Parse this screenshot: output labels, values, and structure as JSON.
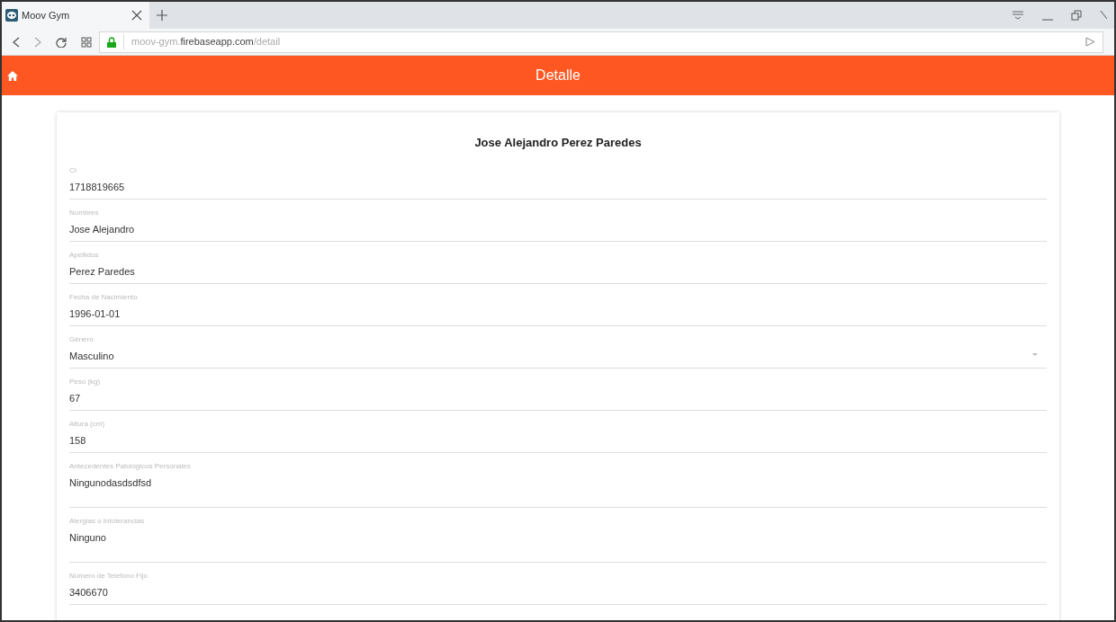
{
  "browser": {
    "tab_title": "Moov Gym",
    "url": {
      "subdomain": "moov-gym.",
      "domain": "firebaseapp.com",
      "path": "/detail"
    }
  },
  "app_bar": {
    "title": "Detalle"
  },
  "card": {
    "title": "Jose Alejandro Perez Paredes",
    "fields": [
      {
        "kind": "text",
        "label": "CI",
        "value": "1718819665"
      },
      {
        "kind": "text",
        "label": "Nombres",
        "value": "Jose Alejandro"
      },
      {
        "kind": "text",
        "label": "Apellidos",
        "value": "Perez Paredes"
      },
      {
        "kind": "text",
        "label": "Fecha de Nacimiento",
        "value": "1996-01-01"
      },
      {
        "kind": "select",
        "label": "Género",
        "value": "Masculino"
      },
      {
        "kind": "text",
        "label": "Peso (kg)",
        "value": "67"
      },
      {
        "kind": "text",
        "label": "Altura (cm)",
        "value": "158"
      },
      {
        "kind": "textarea",
        "label": "Antecedentes Patológicos Personales",
        "value": "Ningunodasdsdfsd"
      },
      {
        "kind": "textarea",
        "label": "Alergias o Intolerancias",
        "value": "Ninguno"
      },
      {
        "kind": "text",
        "label": "Número de Telefono Fijo",
        "value": "3406670"
      }
    ]
  }
}
